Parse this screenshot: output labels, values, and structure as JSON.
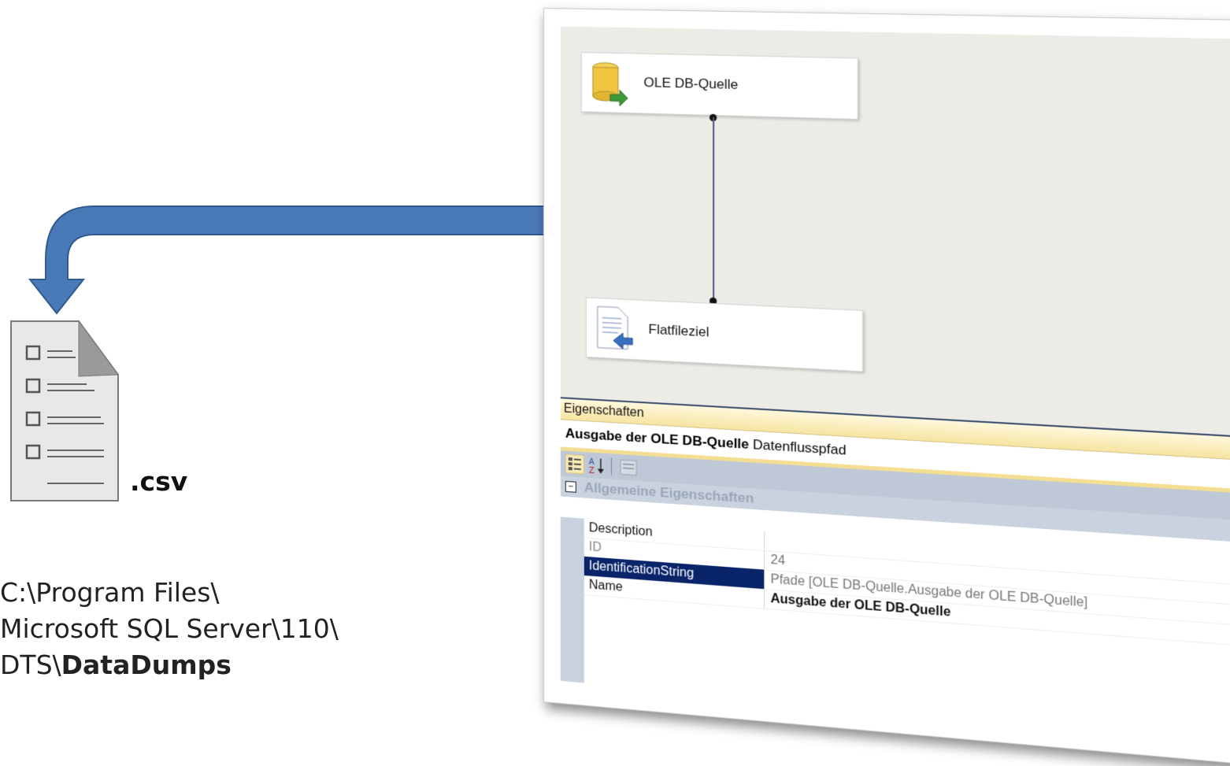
{
  "file": {
    "extension": ".csv",
    "path_prefix_line1": "C:\\Program Files\\",
    "path_prefix_line2": "Microsoft SQL Server\\110\\",
    "path_prefix_line3": "DTS\\",
    "path_bold": "DataDumps"
  },
  "dataflow": {
    "source_label": "OLE DB-Quelle",
    "destination_label": "Flatfileziel"
  },
  "properties": {
    "panel_title": "Eigenschaften",
    "object_name": "Ausgabe der OLE DB-Quelle",
    "object_type": "Datenflusspfad",
    "category": "Allgemeine Eigenschaften",
    "category_expander": "−",
    "rows": [
      {
        "key": "Description",
        "value": ""
      },
      {
        "key": "ID",
        "value": "24"
      },
      {
        "key": "IdentificationString",
        "value": "Pfade [OLE DB-Quelle.Ausgabe der OLE DB-Quelle]"
      },
      {
        "key": "Name",
        "value": "Ausgabe der OLE DB-Quelle"
      }
    ]
  },
  "colors": {
    "arrow_fill": "#4a79b8",
    "arrow_stroke": "#2f5a92",
    "selection": "#0a246a",
    "panel_header": "#f6e4a2"
  },
  "icons": [
    "database-source-icon",
    "flat-file-destination-icon",
    "categorized-sort-icon",
    "alphabetical-sort-icon",
    "property-pages-icon",
    "csv-file-icon"
  ]
}
